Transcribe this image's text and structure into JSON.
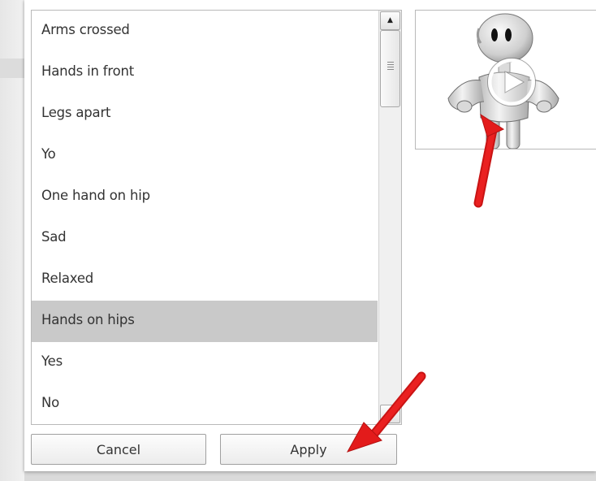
{
  "expression_list": {
    "items": [
      {
        "label": "Arms crossed",
        "selected": false
      },
      {
        "label": "Hands in front",
        "selected": false
      },
      {
        "label": "Legs apart",
        "selected": false
      },
      {
        "label": "Yo",
        "selected": false
      },
      {
        "label": "One hand on hip",
        "selected": false
      },
      {
        "label": "Sad",
        "selected": false
      },
      {
        "label": "Relaxed",
        "selected": false
      },
      {
        "label": "Hands on hips",
        "selected": true
      },
      {
        "label": "Yes",
        "selected": false
      },
      {
        "label": "No",
        "selected": false
      }
    ],
    "scroll_up_icon": "triangle-up-icon",
    "scroll_down_icon": "triangle-down-icon"
  },
  "buttons": {
    "cancel_label": "Cancel",
    "apply_label": "Apply"
  },
  "preview": {
    "character_icon": "robot-character-figure",
    "play_icon": "play-icon"
  },
  "annotations": {
    "arrow_color": "#e31b1b",
    "arrow_icon": "red-arrow"
  },
  "colors": {
    "selected_row": "#c9c9c9",
    "dialog_background": "#ffffff"
  }
}
